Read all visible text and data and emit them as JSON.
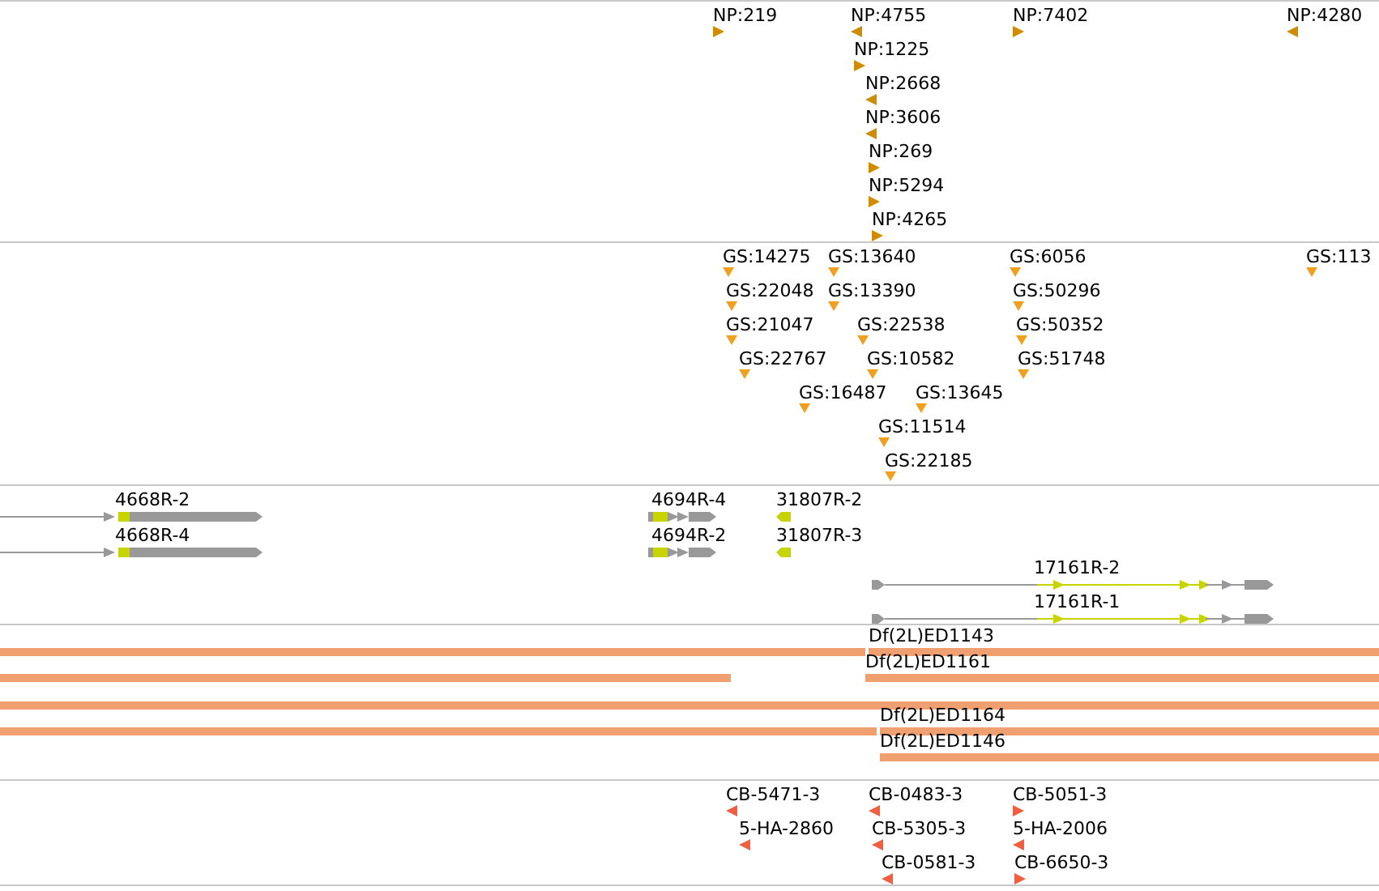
{
  "tracks": [
    {
      "kind": "insertions",
      "features": [
        {
          "label": "NP:219",
          "reverse": false
        },
        {
          "label": "NP:4755",
          "reverse": true
        },
        {
          "label": "NP:7402",
          "reverse": false
        },
        {
          "label": "NP:4280",
          "reverse": true
        },
        {
          "label": "NP:1225",
          "reverse": false
        },
        {
          "label": "NP:2668",
          "reverse": true
        },
        {
          "label": "NP:3606",
          "reverse": true
        },
        {
          "label": "NP:269",
          "reverse": false
        },
        {
          "label": "NP:5294",
          "reverse": false
        },
        {
          "label": "NP:4265",
          "reverse": false
        }
      ]
    },
    {
      "kind": "insertions",
      "features": [
        {
          "label": "GS:14275"
        },
        {
          "label": "GS:13640"
        },
        {
          "label": "GS:6056"
        },
        {
          "label": "GS:113"
        },
        {
          "label": "GS:22048"
        },
        {
          "label": "GS:13390"
        },
        {
          "label": "GS:50296"
        },
        {
          "label": "GS:21047"
        },
        {
          "label": "GS:22538"
        },
        {
          "label": "GS:50352"
        },
        {
          "label": "GS:22767"
        },
        {
          "label": "GS:10582"
        },
        {
          "label": "GS:51748"
        },
        {
          "label": "GS:16487"
        },
        {
          "label": "GS:13645"
        },
        {
          "label": "GS:11514"
        },
        {
          "label": "GS:22185"
        }
      ]
    },
    {
      "kind": "genes",
      "features": [
        {
          "label": "4668R-2"
        },
        {
          "label": "4668R-4"
        },
        {
          "label": "4694R-4"
        },
        {
          "label": "4694R-2"
        },
        {
          "label": "31807R-2"
        },
        {
          "label": "31807R-3"
        },
        {
          "label": "17161R-2"
        },
        {
          "label": "17161R-1"
        }
      ]
    },
    {
      "kind": "deletions",
      "features": [
        {
          "kind": "bar"
        },
        {
          "kind": "bar",
          "label": "Df(2L)ED1143"
        },
        {
          "kind": "bar"
        },
        {
          "kind": "bar",
          "label": "Df(2L)ED1161"
        },
        {
          "kind": "bar"
        },
        {
          "kind": "bar"
        },
        {
          "kind": "bar",
          "label": "Df(2L)ED1164"
        },
        {
          "kind": "bar",
          "label": "Df(2L)ED1146"
        }
      ]
    },
    {
      "kind": "insertions",
      "features": [
        {
          "label": "CB-5471-3",
          "reverse": true
        },
        {
          "label": "CB-0483-3",
          "reverse": true
        },
        {
          "label": "CB-5051-3",
          "reverse": false
        },
        {
          "label": "5-HA-2860",
          "reverse": true
        },
        {
          "label": "CB-5305-3",
          "reverse": true
        },
        {
          "label": "5-HA-2006",
          "reverse": true
        },
        {
          "label": "CB-0581-3",
          "reverse": true
        },
        {
          "label": "CB-6650-3",
          "reverse": false
        }
      ]
    }
  ]
}
